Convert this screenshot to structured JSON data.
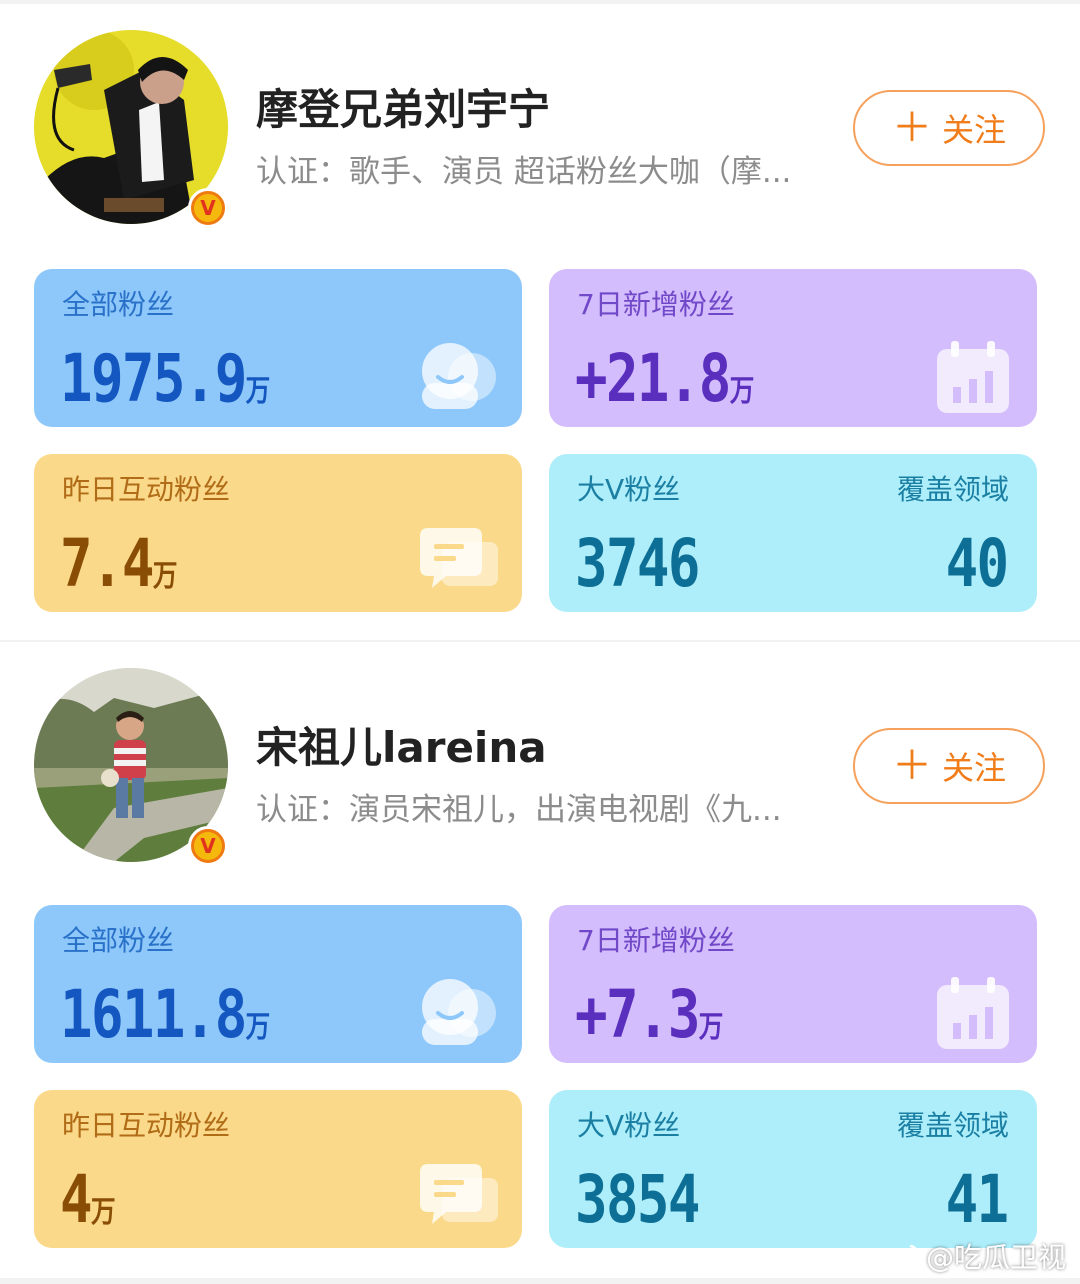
{
  "profiles": [
    {
      "name": "摩登兄弟刘宇宁",
      "certification": "认证：歌手、演员 超话粉丝大咖（摩...",
      "follow_label": "关注",
      "stats": {
        "total_fans": {
          "label": "全部粉丝",
          "value": "1975.9",
          "unit": "万"
        },
        "new_7d": {
          "label": "7日新增粉丝",
          "value": "+21.8",
          "unit": "万"
        },
        "interactive_yesterday": {
          "label": "昨日互动粉丝",
          "value": "7.4",
          "unit": "万"
        },
        "big_v": {
          "label": "大V粉丝",
          "value": "3746"
        },
        "coverage": {
          "label": "覆盖领域",
          "value": "40"
        }
      }
    },
    {
      "name": "宋祖儿lareina",
      "certification": "认证：演员宋祖儿，出演电视剧《九...",
      "follow_label": "关注",
      "stats": {
        "total_fans": {
          "label": "全部粉丝",
          "value": "1611.8",
          "unit": "万"
        },
        "new_7d": {
          "label": "7日新增粉丝",
          "value": "+7.3",
          "unit": "万"
        },
        "interactive_yesterday": {
          "label": "昨日互动粉丝",
          "value": "4",
          "unit": "万"
        },
        "big_v": {
          "label": "大V粉丝",
          "value": "3854"
        },
        "coverage": {
          "label": "覆盖领域",
          "value": "41"
        }
      }
    }
  ],
  "watermark": "@吃瓜卫视",
  "icons": [
    "verified-badge-icon",
    "plus-icon",
    "fans-icon",
    "calendar-chart-icon",
    "chat-icon",
    "weibo-logo-icon"
  ],
  "colors": {
    "accent_orange": "#f07c1a",
    "tile_blue": "#8ec8fa",
    "tile_purple": "#d4bdfc",
    "tile_yellow": "#fbd98a",
    "tile_cyan": "#aeeefa"
  }
}
